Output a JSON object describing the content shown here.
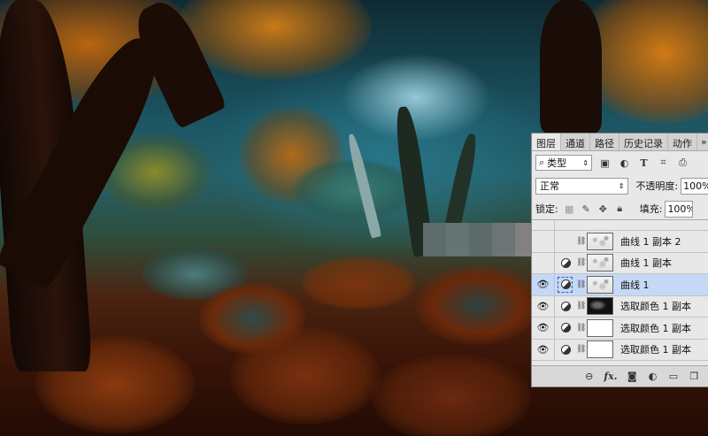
{
  "panel": {
    "tabs": [
      {
        "label": "图层"
      },
      {
        "label": "通道"
      },
      {
        "label": "路径"
      },
      {
        "label": "历史记录"
      },
      {
        "label": "动作"
      },
      {
        "label": "»"
      }
    ],
    "filter": {
      "label": "类型",
      "icon": "search-icon"
    },
    "filter_icons": [
      "image-filter-icon",
      "adjustment-filter-icon",
      "text-filter-icon",
      "shape-filter-icon",
      "smart-object-filter-icon"
    ],
    "blend_mode": "正常",
    "opacity_label": "不透明度:",
    "opacity_value": "100%",
    "lock_label": "锁定:",
    "fill_label": "填充:",
    "fill_value": "100%",
    "layers": [
      {
        "name": "曲线 1 副本 2",
        "visible": false,
        "mask": "noise"
      },
      {
        "name": "曲线 1 副本",
        "visible": false,
        "mask": "noise"
      },
      {
        "name": "曲线 1",
        "visible": true,
        "mask": "noise",
        "selected": true
      },
      {
        "name": "选取颜色 1 副本",
        "visible": true,
        "mask": "dark"
      },
      {
        "name": "选取颜色 1 副本",
        "visible": true,
        "mask": "white"
      },
      {
        "name": "选取颜色 1 副本",
        "visible": true,
        "mask": "white"
      }
    ],
    "bottom_icons": [
      "link-icon",
      "fx-icon",
      "add-mask-icon",
      "new-adjustment-icon",
      "new-group-icon",
      "new-layer-icon"
    ],
    "fx_label": "fx."
  },
  "colors": {
    "panel_bg": "#e8e8e8",
    "selection": "#c5d9f7",
    "foliage": "#c86a10"
  }
}
